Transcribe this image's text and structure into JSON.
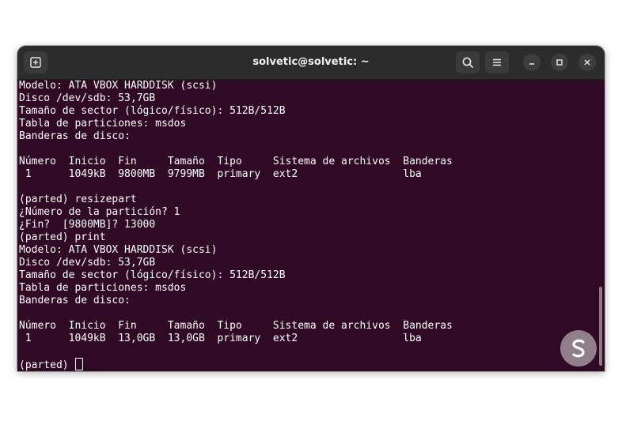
{
  "window": {
    "title": "solvetic@solvetic: ~"
  },
  "titlebar": {
    "new_tab_icon": "new-tab-icon",
    "search_icon": "search-icon",
    "menu_icon": "hamburger-menu-icon",
    "minimize_icon": "minimize-icon",
    "maximize_icon": "maximize-icon",
    "close_icon": "close-icon"
  },
  "terminal": {
    "lines": [
      "Modelo: ATA VBOX HARDDISK (scsi)",
      "Disco /dev/sdb: 53,7GB",
      "Tamaño de sector (lógico/físico): 512B/512B",
      "Tabla de particiones: msdos",
      "Banderas de disco:",
      "",
      "Número  Inicio  Fin     Tamaño  Tipo     Sistema de archivos  Banderas",
      " 1      1049kB  9800MB  9799MB  primary  ext2                 lba",
      "",
      "(parted) resizepart",
      "¿Número de la partición? 1",
      "¿Fin?  [9800MB]? 13000",
      "(parted) print",
      "Modelo: ATA VBOX HARDDISK (scsi)",
      "Disco /dev/sdb: 53,7GB",
      "Tamaño de sector (lógico/físico): 512B/512B",
      "Tabla de particiones: msdos",
      "Banderas de disco:",
      "",
      "Número  Inicio  Fin     Tamaño  Tipo     Sistema de archivos  Banderas",
      " 1      1049kB  13,0GB  13,0GB  primary  ext2                 lba",
      "",
      "(parted) "
    ]
  },
  "colors": {
    "terminal_bg": "#300a24",
    "titlebar_bg": "#2c2c2c",
    "text": "#ffffff"
  },
  "watermark": {
    "logo_icon": "solvetic-logo-icon"
  }
}
